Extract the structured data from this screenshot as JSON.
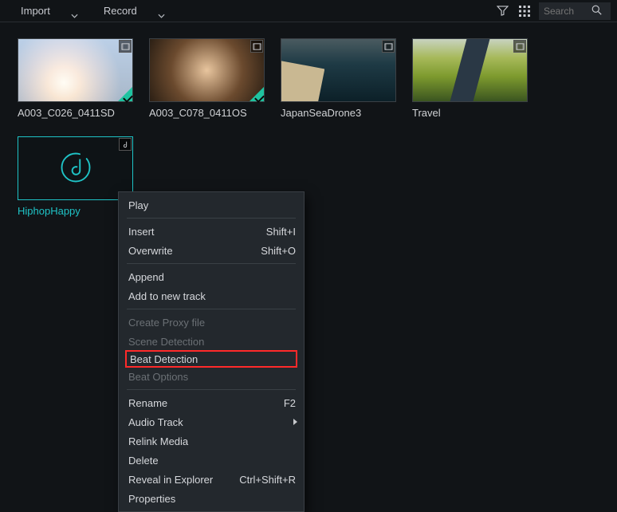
{
  "toolbar": {
    "import_label": "Import",
    "record_label": "Record",
    "search_placeholder": "Search"
  },
  "media": [
    {
      "label": "A003_C026_0411SD",
      "type": "video",
      "checked": true,
      "style": "g1"
    },
    {
      "label": "A003_C078_0411OS",
      "type": "video",
      "checked": true,
      "style": "g2"
    },
    {
      "label": "JapanSeaDrone3",
      "type": "video",
      "checked": false,
      "style": "g3"
    },
    {
      "label": "Travel",
      "type": "video",
      "checked": false,
      "style": "g4"
    },
    {
      "label": "HiphopHappy",
      "type": "audio",
      "checked": false,
      "selected": true
    }
  ],
  "context_menu": {
    "play": "Play",
    "insert": "Insert",
    "insert_short": "Shift+I",
    "overwrite": "Overwrite",
    "overwrite_short": "Shift+O",
    "append": "Append",
    "add_new_track": "Add to new track",
    "create_proxy": "Create Proxy file",
    "scene_detection": "Scene Detection",
    "beat_detection": "Beat Detection",
    "beat_options": "Beat Options",
    "rename": "Rename",
    "rename_short": "F2",
    "audio_track": "Audio Track",
    "relink_media": "Relink Media",
    "delete": "Delete",
    "reveal": "Reveal in Explorer",
    "reveal_short": "Ctrl+Shift+R",
    "properties": "Properties"
  }
}
